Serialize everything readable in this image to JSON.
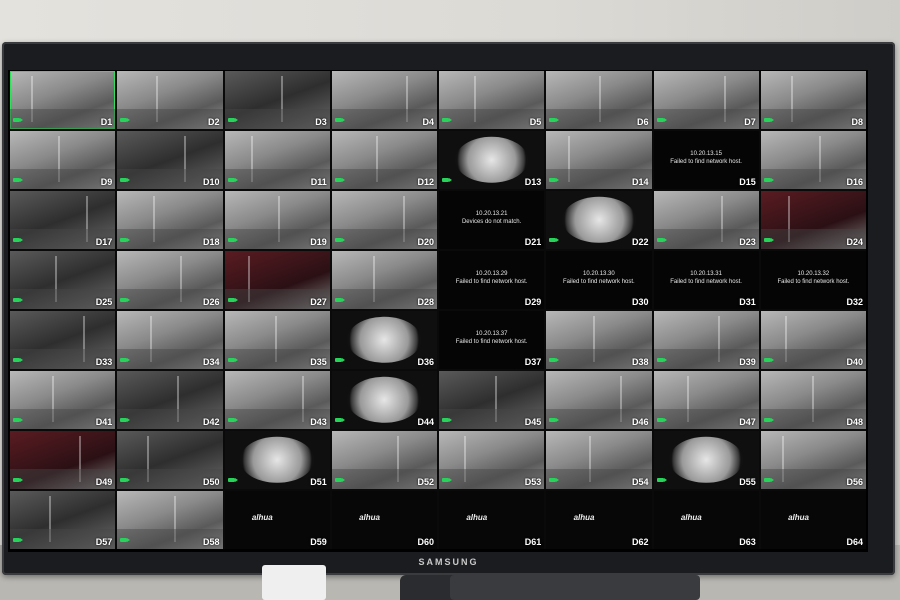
{
  "monitor": {
    "brand": "SAMSUNG"
  },
  "colors": {
    "selected_outline": "#2ee05a",
    "record_indicator": "#27d35a",
    "error_background": "#050505"
  },
  "channels": [
    {
      "label": "D1",
      "kind": "cam",
      "selected": true
    },
    {
      "label": "D2",
      "kind": "cam"
    },
    {
      "label": "D3",
      "kind": "dark"
    },
    {
      "label": "D4",
      "kind": "cam"
    },
    {
      "label": "D5",
      "kind": "cam"
    },
    {
      "label": "D6",
      "kind": "cam"
    },
    {
      "label": "D7",
      "kind": "cam"
    },
    {
      "label": "D8",
      "kind": "cam"
    },
    {
      "label": "D9",
      "kind": "cam"
    },
    {
      "label": "D10",
      "kind": "dark"
    },
    {
      "label": "D11",
      "kind": "cam"
    },
    {
      "label": "D12",
      "kind": "cam"
    },
    {
      "label": "D13",
      "kind": "fish"
    },
    {
      "label": "D14",
      "kind": "cam"
    },
    {
      "label": "D15",
      "kind": "err",
      "msg_ip": "10.20.13.15",
      "msg": "Failed to find network host."
    },
    {
      "label": "D16",
      "kind": "cam"
    },
    {
      "label": "D17",
      "kind": "dark"
    },
    {
      "label": "D18",
      "kind": "cam"
    },
    {
      "label": "D19",
      "kind": "cam"
    },
    {
      "label": "D20",
      "kind": "cam"
    },
    {
      "label": "D21",
      "kind": "err",
      "msg_ip": "10.20.13.21",
      "msg": "Devices do not match."
    },
    {
      "label": "D22",
      "kind": "fish"
    },
    {
      "label": "D23",
      "kind": "cam"
    },
    {
      "label": "D24",
      "kind": "red"
    },
    {
      "label": "D25",
      "kind": "dark"
    },
    {
      "label": "D26",
      "kind": "cam"
    },
    {
      "label": "D27",
      "kind": "red"
    },
    {
      "label": "D28",
      "kind": "cam"
    },
    {
      "label": "D29",
      "kind": "err",
      "msg_ip": "10.20.13.29",
      "msg": "Failed to find network host."
    },
    {
      "label": "D30",
      "kind": "err",
      "msg_ip": "10.20.13.30",
      "msg": "Failed to find network host."
    },
    {
      "label": "D31",
      "kind": "err",
      "msg_ip": "10.20.13.31",
      "msg": "Failed to find network host."
    },
    {
      "label": "D32",
      "kind": "err",
      "msg_ip": "10.20.13.32",
      "msg": "Failed to find network host."
    },
    {
      "label": "D33",
      "kind": "dark"
    },
    {
      "label": "D34",
      "kind": "cam"
    },
    {
      "label": "D35",
      "kind": "cam"
    },
    {
      "label": "D36",
      "kind": "fish"
    },
    {
      "label": "D37",
      "kind": "err",
      "msg_ip": "10.20.13.37",
      "msg": "Failed to find network host."
    },
    {
      "label": "D38",
      "kind": "cam"
    },
    {
      "label": "D39",
      "kind": "cam"
    },
    {
      "label": "D40",
      "kind": "cam"
    },
    {
      "label": "D41",
      "kind": "cam"
    },
    {
      "label": "D42",
      "kind": "dark"
    },
    {
      "label": "D43",
      "kind": "cam"
    },
    {
      "label": "D44",
      "kind": "fish"
    },
    {
      "label": "D45",
      "kind": "dark"
    },
    {
      "label": "D46",
      "kind": "cam"
    },
    {
      "label": "D47",
      "kind": "cam"
    },
    {
      "label": "D48",
      "kind": "cam"
    },
    {
      "label": "D49",
      "kind": "red"
    },
    {
      "label": "D50",
      "kind": "dark"
    },
    {
      "label": "D51",
      "kind": "fish"
    },
    {
      "label": "D52",
      "kind": "cam"
    },
    {
      "label": "D53",
      "kind": "cam"
    },
    {
      "label": "D54",
      "kind": "cam"
    },
    {
      "label": "D55",
      "kind": "fish"
    },
    {
      "label": "D56",
      "kind": "cam"
    },
    {
      "label": "D57",
      "kind": "dark"
    },
    {
      "label": "D58",
      "kind": "cam"
    },
    {
      "label": "D59",
      "kind": "logo",
      "logo": "alhua"
    },
    {
      "label": "D60",
      "kind": "logo",
      "logo": "alhua"
    },
    {
      "label": "D61",
      "kind": "logo",
      "logo": "alhua"
    },
    {
      "label": "D62",
      "kind": "logo",
      "logo": "alhua"
    },
    {
      "label": "D63",
      "kind": "logo",
      "logo": "alhua"
    },
    {
      "label": "D64",
      "kind": "logo",
      "logo": "alhua"
    }
  ]
}
